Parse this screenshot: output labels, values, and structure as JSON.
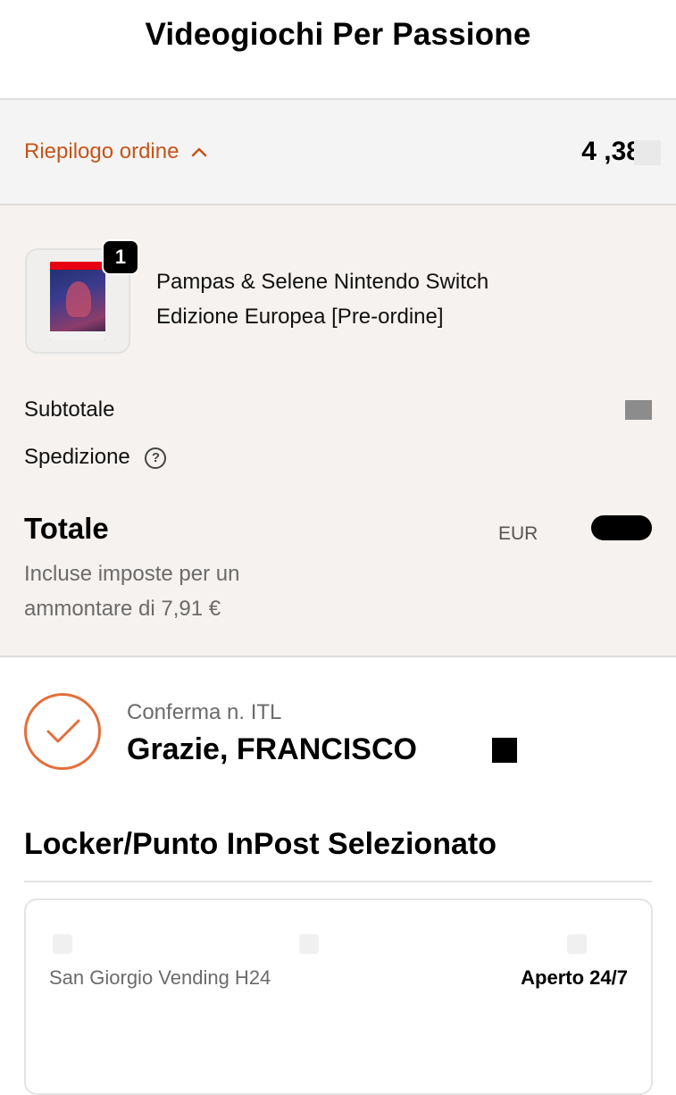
{
  "header": {
    "store_name": "Videogiochi Per Passione"
  },
  "summary_toggle": {
    "label": "Riepilogo ordine",
    "price_partial": "4 ,38"
  },
  "order": {
    "badge_count": "1",
    "product_name": "Pampas & Selene Nintendo Switch Edizione Europea [Pre-ordine]",
    "subtotal_label": "Subtotale",
    "shipping_label": "Spedizione",
    "shipping_help": "?",
    "total_label": "Totale",
    "total_currency": "EUR",
    "tax_note": "Incluse imposte per un ammontare di 7,91 €"
  },
  "confirmation": {
    "number_label": "Conferma n.        ITL",
    "thanks": "Grazie, FRANCISCO"
  },
  "locker": {
    "section_title": "Locker/Punto InPost Selezionato",
    "point_name": "San Giorgio Vending H24",
    "hours": "Aperto 24/7"
  },
  "colors": {
    "accent": "#c4541a",
    "check_ring": "#e36f3b",
    "summary_bg": "#f4f4f4",
    "order_bg": "#f5f2ef"
  },
  "icons": {
    "summary_toggle": "chevron-up-icon",
    "shipping_help": "question-circle-icon",
    "confirmation": "check-circle-icon"
  }
}
